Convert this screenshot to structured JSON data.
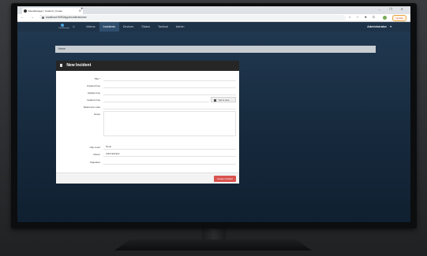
{
  "browser": {
    "tab_title": "VideoManager | Incident | Create",
    "new_tab": "+",
    "window_controls": "– ❐ ✕",
    "nav_arrows": "← → C",
    "url": "localhost:9090/app/incidents/new",
    "ext_icons": "⌕ ☆ ✱ ▢",
    "update_label": "Update"
  },
  "app": {
    "logo_text": "VideoManager",
    "home_icon": "home-icon",
    "menu": [
      "Videos",
      "Incidents",
      "Devices",
      "Status",
      "Tactical",
      "Admin"
    ],
    "active_menu": "Incidents",
    "user": "Administrator",
    "user_caret": "▾"
  },
  "breadcrumb": "Home",
  "panel": {
    "title": "New Incident",
    "fields": [
      {
        "label": "Title *",
        "value": ""
      },
      {
        "label": "Created time",
        "value": ""
      },
      {
        "label": "Update time",
        "value": ""
      },
      {
        "label": "Incident time",
        "value": "",
        "button": "Set to now"
      },
      {
        "label": "Reference code",
        "value": ""
      },
      {
        "label": "Notes",
        "value": ""
      },
      {
        "label": "Clip count",
        "value": "None"
      },
      {
        "label": "Owner",
        "value": "Administrator"
      },
      {
        "label": "Signature",
        "value": ""
      }
    ],
    "create_label": "Create incident"
  }
}
